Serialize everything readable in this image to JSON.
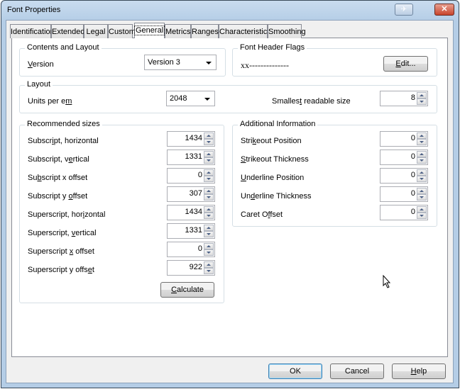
{
  "window": {
    "title": "Font Properties",
    "pin_icon": "pin-icon",
    "close_icon": "close-icon"
  },
  "tabs": [
    {
      "label": "Identification"
    },
    {
      "label": "Extended"
    },
    {
      "label": "Legal"
    },
    {
      "label": "Custom"
    },
    {
      "label": "General",
      "selected": true
    },
    {
      "label": "Metrics"
    },
    {
      "label": "Ranges"
    },
    {
      "label": "Characteristics"
    },
    {
      "label": "Smoothing"
    }
  ],
  "contents": {
    "title": "Contents and Layout",
    "version_label": "Version",
    "version_mn": "V",
    "version_value": "Version 3"
  },
  "flags": {
    "title": "Font Header Flags",
    "value": "xx--------------",
    "edit_label": "Edit...",
    "edit_mn": "E"
  },
  "layout": {
    "title": "Layout",
    "units_label": "Units per em",
    "units_mn": "m",
    "units_value": "2048",
    "smallest_label": "Smallest readable size",
    "smallest_mn": "t",
    "smallest_value": "8"
  },
  "recommended": {
    "title": "Recommended sizes",
    "items": [
      {
        "label": "Subscript, horizontal",
        "mn": 6,
        "value": "1434"
      },
      {
        "label": "Subscript, vertical",
        "mn": 12,
        "value": "1331"
      },
      {
        "label": "Subscript x offset",
        "mn": 2,
        "value": "0"
      },
      {
        "label": "Subscript y offset",
        "mn": 12,
        "value": "307"
      },
      {
        "label": "Superscript, horizontal",
        "mn": 16,
        "value": "1434"
      },
      {
        "label": "Superscript, vertical",
        "mn": 13,
        "value": "1331"
      },
      {
        "label": "Superscript x offset",
        "mn": 12,
        "value": "0"
      },
      {
        "label": "Superscript y offset",
        "mn": 18,
        "value": "922"
      }
    ],
    "calculate_label": "Calculate"
  },
  "additional": {
    "title": "Additional Information",
    "items": [
      {
        "label": "Strikeout Position",
        "mn": 4,
        "value": "0"
      },
      {
        "label": "Strikeout Thickness",
        "mn": 0,
        "value": "0"
      },
      {
        "label": "Underline Position",
        "mn": 0,
        "value": "0"
      },
      {
        "label": "Underline Thickness",
        "mn": 2,
        "value": "0"
      },
      {
        "label": "Caret Offset",
        "mn": 7,
        "value": "0"
      }
    ]
  },
  "footer": {
    "ok": "OK",
    "cancel": "Cancel",
    "help": "Help"
  }
}
